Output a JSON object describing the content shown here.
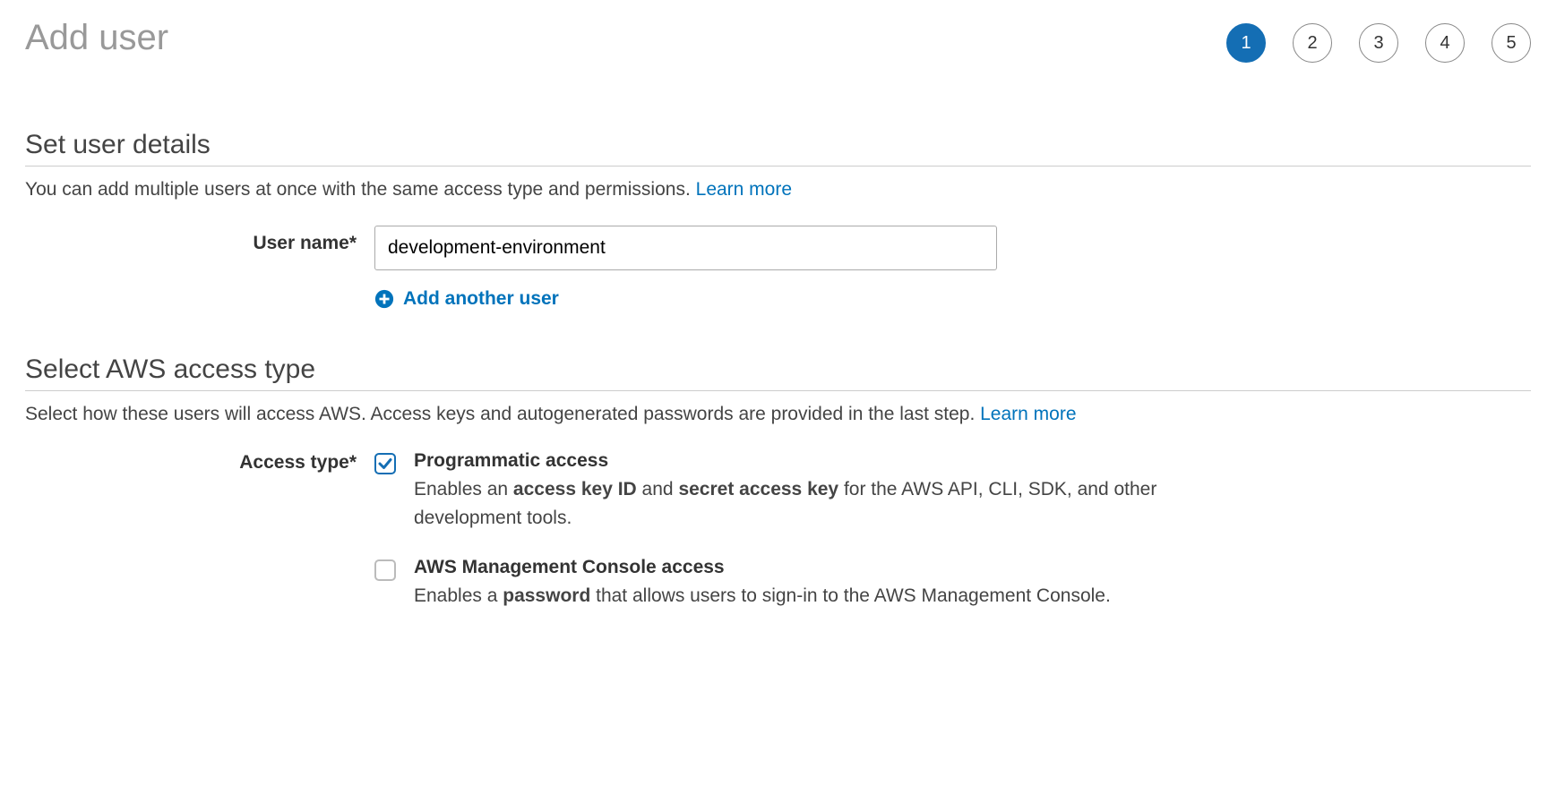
{
  "page": {
    "title": "Add user",
    "steps": [
      "1",
      "2",
      "3",
      "4",
      "5"
    ],
    "current_step": 1
  },
  "user_details": {
    "section_title": "Set user details",
    "help_text": "You can add multiple users at once with the same access type and permissions. ",
    "learn_more": "Learn more",
    "username_label": "User name*",
    "username_value": "development-environment",
    "add_another": "Add another user"
  },
  "access_type": {
    "section_title": "Select AWS access type",
    "help_text": "Select how these users will access AWS. Access keys and autogenerated passwords are provided in the last step. ",
    "learn_more": "Learn more",
    "label": "Access type*",
    "options": [
      {
        "title": "Programmatic access",
        "checked": true,
        "desc_pre": "Enables an ",
        "desc_b1": "access key ID",
        "desc_mid": " and ",
        "desc_b2": "secret access key",
        "desc_post": " for the AWS API, CLI, SDK, and other development tools."
      },
      {
        "title": "AWS Management Console access",
        "checked": false,
        "desc_pre": "Enables a ",
        "desc_b1": "password",
        "desc_mid": "",
        "desc_b2": "",
        "desc_post": " that allows users to sign-in to the AWS Management Console."
      }
    ]
  }
}
